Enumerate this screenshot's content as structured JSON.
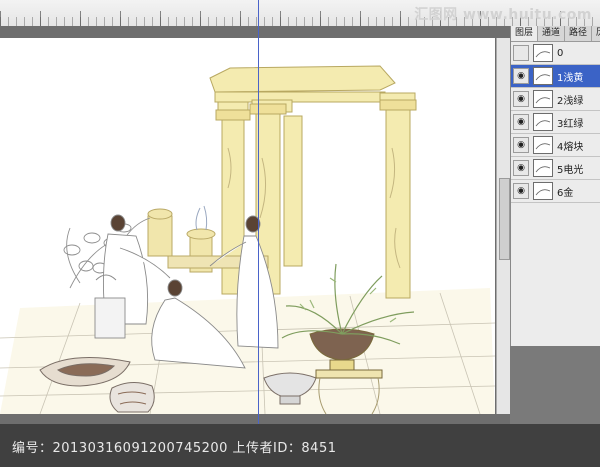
{
  "watermark": "汇图网 www.huitu.com",
  "layers_panel": {
    "tabs": [
      "图层",
      "通道",
      "路径",
      "历"
    ],
    "layers": [
      {
        "name": "0",
        "visible": false,
        "selected": false
      },
      {
        "name": "1浅黄",
        "visible": true,
        "selected": true
      },
      {
        "name": "2浅绿",
        "visible": true,
        "selected": false
      },
      {
        "name": "3红绿",
        "visible": true,
        "selected": false
      },
      {
        "name": "4熔块",
        "visible": true,
        "selected": false
      },
      {
        "name": "5电光",
        "visible": true,
        "selected": false
      },
      {
        "name": "6金",
        "visible": true,
        "selected": false
      }
    ]
  },
  "caption": "编号：20130316091200745200 上传者ID：8451",
  "colors": {
    "guide": "#4a63c9",
    "selection": "#3b63c6",
    "column": "#f4ebb0"
  }
}
